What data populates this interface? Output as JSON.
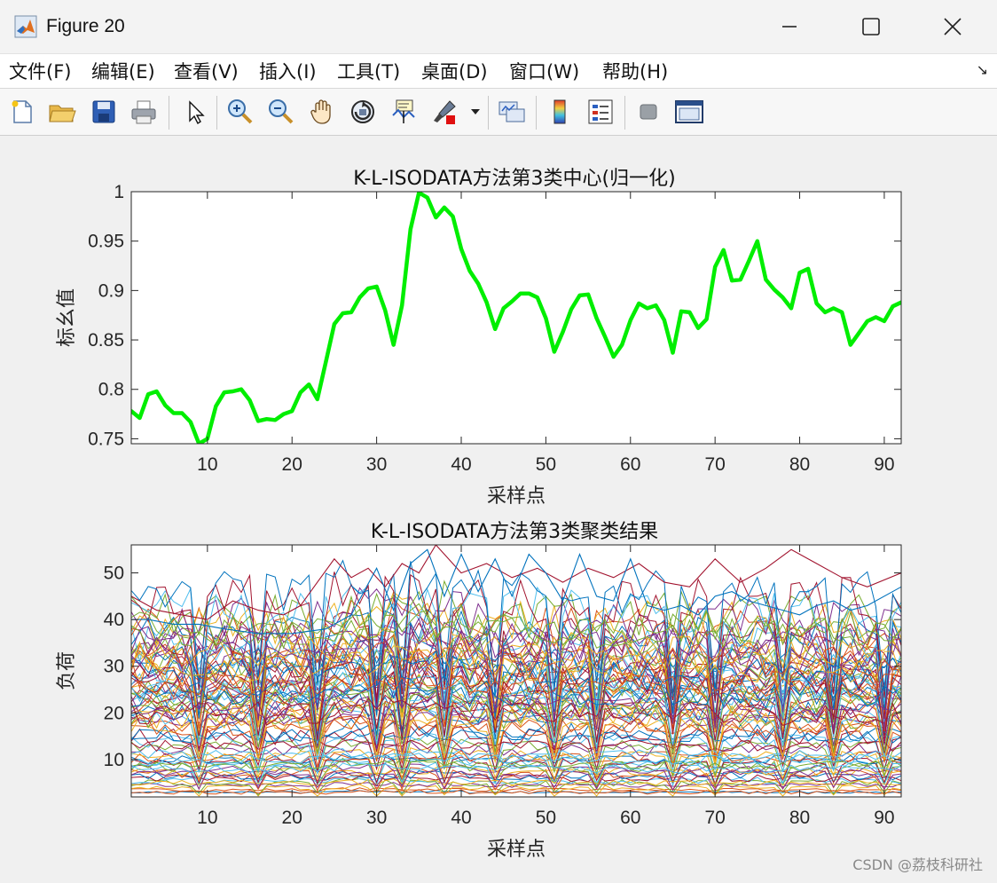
{
  "window": {
    "title": "Figure 20",
    "minimize_icon": "minimize-icon",
    "maximize_icon": "maximize-icon",
    "close_icon": "close-icon"
  },
  "menu": {
    "items": [
      "文件(F)",
      "编辑(E)",
      "查看(V)",
      "插入(I)",
      "工具(T)",
      "桌面(D)",
      "窗口(W)",
      "帮助(H)"
    ],
    "arrow_glyph": "↘"
  },
  "toolbar": {
    "icons": [
      "new-file-icon",
      "open-folder-icon",
      "save-icon",
      "print-icon",
      "pointer-icon",
      "zoom-in-icon",
      "zoom-out-icon",
      "pan-hand-icon",
      "rotate-3d-icon",
      "data-cursor-icon",
      "brush-icon",
      "link-plot-icon",
      "colorbar-icon",
      "legend-icon",
      "hide-tools-icon",
      "dock-icon"
    ]
  },
  "watermark": "CSDN @荔枝科研社",
  "chart_data": [
    {
      "type": "line",
      "title": "K-L-ISODATA方法第3类中心(归一化)",
      "xlabel": "采样点",
      "ylabel": "标幺值",
      "xlim": [
        1,
        92
      ],
      "ylim": [
        0.745,
        1.0
      ],
      "xticks": [
        10,
        20,
        30,
        40,
        50,
        60,
        70,
        80,
        90
      ],
      "yticks": [
        0.75,
        0.8,
        0.85,
        0.9,
        0.95,
        1
      ],
      "ytick_labels": [
        "0.75",
        "0.8",
        "0.85",
        "0.9",
        "0.95",
        "1"
      ],
      "grid": false,
      "series": [
        {
          "color": "#00ee00",
          "x": [
            1,
            2,
            3,
            4,
            5,
            6,
            7,
            8,
            9,
            10,
            11,
            12,
            13,
            14,
            15,
            16,
            17,
            18,
            19,
            20,
            21,
            22,
            23,
            24,
            25,
            26,
            27,
            28,
            29,
            30,
            31,
            32,
            33,
            34,
            35,
            36,
            37,
            38,
            39,
            40,
            41,
            42,
            43,
            44,
            45,
            46,
            47,
            48,
            49,
            50,
            51,
            52,
            53,
            54,
            55,
            56,
            57,
            58,
            59,
            60,
            61,
            62,
            63,
            64,
            65,
            66,
            67,
            68,
            69,
            70,
            71,
            72,
            73,
            74,
            75,
            76,
            77,
            78,
            79,
            80,
            81,
            82,
            83,
            84,
            85,
            86,
            87,
            88,
            89,
            90,
            91,
            92
          ],
          "values": [
            0.778,
            0.771,
            0.795,
            0.798,
            0.784,
            0.776,
            0.776,
            0.767,
            0.745,
            0.75,
            0.783,
            0.797,
            0.798,
            0.8,
            0.789,
            0.768,
            0.77,
            0.769,
            0.775,
            0.778,
            0.797,
            0.805,
            0.79,
            0.828,
            0.866,
            0.877,
            0.878,
            0.893,
            0.902,
            0.904,
            0.88,
            0.845,
            0.885,
            0.962,
            0.999,
            0.994,
            0.974,
            0.984,
            0.975,
            0.942,
            0.92,
            0.907,
            0.888,
            0.861,
            0.882,
            0.889,
            0.897,
            0.897,
            0.893,
            0.872,
            0.838,
            0.858,
            0.881,
            0.895,
            0.896,
            0.872,
            0.853,
            0.833,
            0.845,
            0.87,
            0.887,
            0.882,
            0.885,
            0.87,
            0.837,
            0.879,
            0.878,
            0.862,
            0.871,
            0.924,
            0.941,
            0.91,
            0.911,
            0.93,
            0.95,
            0.911,
            0.901,
            0.893,
            0.882,
            0.918,
            0.922,
            0.887,
            0.878,
            0.882,
            0.878,
            0.845,
            0.857,
            0.869,
            0.873,
            0.869,
            0.884,
            0.888
          ]
        }
      ]
    },
    {
      "type": "line",
      "title": "K-L-ISODATA方法第3类聚类结果",
      "xlabel": "采样点",
      "ylabel": "负荷",
      "xlim": [
        1,
        92
      ],
      "ylim": [
        2,
        56
      ],
      "xticks": [
        10,
        20,
        30,
        40,
        50,
        60,
        70,
        80,
        90
      ],
      "yticks": [
        10,
        20,
        30,
        40,
        50
      ],
      "ytick_labels": [
        "10",
        "20",
        "30",
        "40",
        "50"
      ],
      "grid": false,
      "line_colors": [
        "#0072bd",
        "#d95319",
        "#edb120",
        "#7e2f8e",
        "#77ac30",
        "#4dbeee",
        "#a2142f"
      ],
      "series_count": 90,
      "series_levels": [
        3,
        3.5,
        4,
        4.5,
        5,
        5.5,
        6,
        6.5,
        7,
        7.5,
        8,
        8.5,
        9,
        9.5,
        10,
        10.5,
        11,
        12,
        13,
        14,
        15,
        16,
        17,
        18,
        18.5,
        19,
        19.5,
        20,
        20.5,
        21,
        21.5,
        22,
        22.5,
        23,
        23.5,
        24,
        24.5,
        25,
        25.5,
        26,
        26.5,
        27,
        28,
        28.5,
        29,
        29.5,
        30,
        30.5,
        31,
        31.5,
        32,
        32.5,
        33,
        34,
        35,
        36,
        37,
        38,
        39,
        40,
        41,
        42,
        44,
        46,
        3,
        5,
        7,
        9,
        11,
        13,
        15,
        17,
        19,
        21,
        23,
        25,
        27,
        29,
        31,
        33,
        35,
        37,
        10,
        20,
        24,
        26,
        30,
        34,
        38,
        8
      ],
      "highlighted_series": [
        {
          "color": "#a2142f",
          "x": [
            1,
            4,
            7,
            10,
            13,
            16,
            19,
            21,
            23,
            25,
            27,
            29,
            31,
            33,
            35,
            37,
            40,
            43,
            46,
            49,
            52,
            55,
            58,
            61,
            64,
            67,
            70,
            73,
            76,
            79,
            82,
            85,
            88,
            92
          ],
          "values": [
            45,
            42,
            41,
            40,
            44,
            42,
            41,
            43,
            48,
            53,
            49,
            51,
            47,
            52,
            50,
            56,
            50,
            52,
            49,
            51,
            48,
            51,
            49,
            52,
            48,
            47,
            53,
            48,
            51,
            55,
            52,
            49,
            47,
            50
          ]
        },
        {
          "color": "#0072bd",
          "x": [
            1,
            3,
            6,
            9,
            12,
            16,
            20,
            24,
            27,
            30,
            32,
            34,
            36,
            38,
            40,
            42,
            44,
            46,
            48,
            50,
            52,
            54,
            56,
            58,
            60,
            62,
            64,
            66,
            68,
            70,
            72,
            74,
            76,
            78,
            80,
            82,
            84,
            86,
            88,
            92
          ],
          "values": [
            40,
            40,
            39,
            39,
            38,
            37,
            37,
            38,
            41,
            51,
            42,
            52,
            55,
            45,
            54,
            46,
            53,
            45,
            54,
            50,
            44,
            54,
            45,
            44,
            53,
            43,
            42,
            43,
            41,
            45,
            46,
            44,
            43,
            42,
            41,
            43,
            44,
            42,
            43,
            47
          ]
        }
      ]
    }
  ]
}
